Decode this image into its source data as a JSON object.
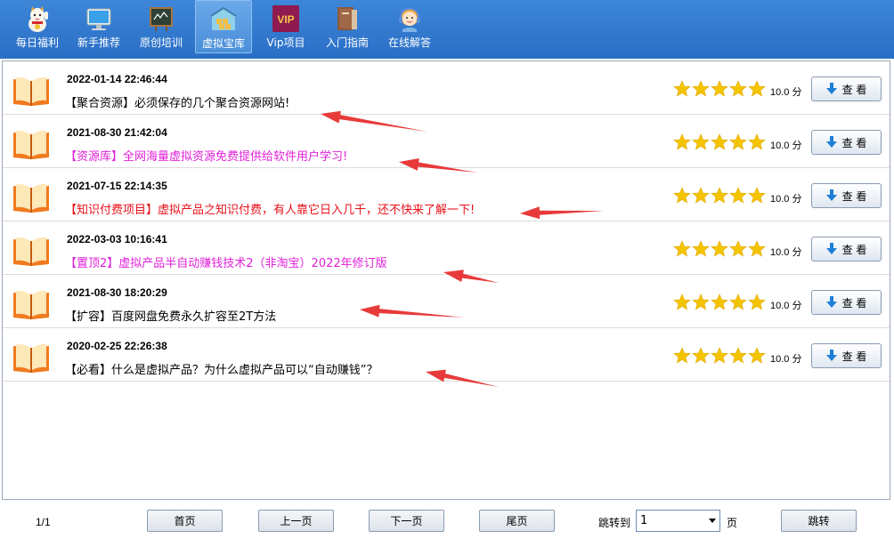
{
  "toolbar": {
    "items": [
      {
        "label": "每日福利",
        "icon": "lucky-cat-icon"
      },
      {
        "label": "新手推荐",
        "icon": "monitor-icon"
      },
      {
        "label": "原创培训",
        "icon": "chalkboard-icon"
      },
      {
        "label": "虚拟宝库",
        "icon": "warehouse-icon",
        "active": true
      },
      {
        "label": "Vip项目",
        "icon": "vip-icon"
      },
      {
        "label": "入门指南",
        "icon": "book-stack-icon"
      },
      {
        "label": "在线解答",
        "icon": "support-agent-icon"
      }
    ]
  },
  "list": {
    "view_label": "查 看",
    "score_unit": "分",
    "items": [
      {
        "date": "2022-01-14 22:46:44",
        "title": "【聚合资源】必须保存的几个聚合资源网站!",
        "color": "#000000",
        "rating": 5,
        "score": "10.0"
      },
      {
        "date": "2021-08-30 21:42:04",
        "title": "【资源库】全网海量虚拟资源免费提供给软件用户学习!",
        "color": "#e020d8",
        "rating": 5,
        "score": "10.0"
      },
      {
        "date": "2021-07-15 22:14:35",
        "title": "【知识付费项目】虚拟产品之知识付费，有人靠它日入几千，还不快来了解一下!",
        "color": "#e8101a",
        "rating": 5,
        "score": "10.0"
      },
      {
        "date": "2022-03-03 10:16:41",
        "title": "【置顶2】虚拟产品半自动赚钱技术2（非淘宝）2022年修订版",
        "color": "#e020d8",
        "rating": 5,
        "score": "10.0"
      },
      {
        "date": "2021-08-30 18:20:29",
        "title": "【扩容】百度网盘免费永久扩容至2T方法",
        "color": "#000000",
        "rating": 5,
        "score": "10.0"
      },
      {
        "date": "2020-02-25 22:26:38",
        "title": "【必看】什么是虚拟产品？为什么虚拟产品可以“自动赚钱”？",
        "color": "#000000",
        "rating": 5,
        "score": "10.0"
      }
    ]
  },
  "pagination": {
    "page_count": "1/1",
    "first": "首页",
    "prev": "上一页",
    "next": "下一页",
    "last": "尾页",
    "jump_label": "跳转到",
    "selected_page": "1",
    "page_unit": "页",
    "jump_button": "跳转"
  },
  "colors": {
    "toolbar": "#2f78cf",
    "star": "#f5c400",
    "annotation_arrow": "#e83a3a"
  }
}
